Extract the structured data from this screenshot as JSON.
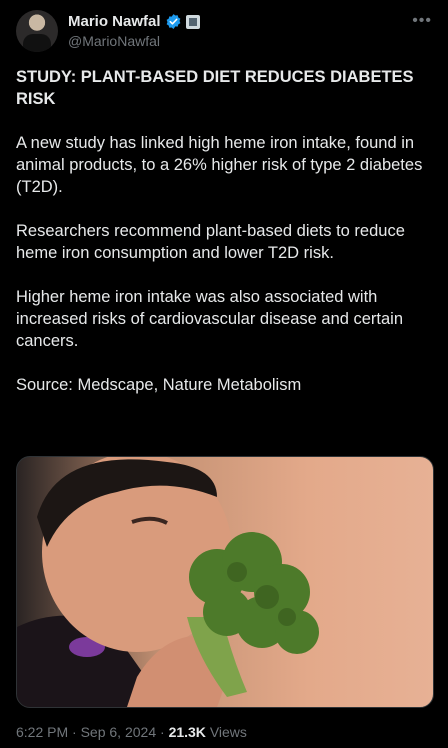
{
  "author": {
    "display_name": "Mario Nawfal",
    "handle": "@MarioNawfal",
    "verified_icon": "verified-badge-icon",
    "affiliation_icon": "affiliation-badge-icon"
  },
  "more_icon": "more-horizontal-icon",
  "post": {
    "headline": "STUDY: PLANT-BASED DIET REDUCES DIABETES RISK",
    "paragraphs": [
      "A new study has linked high heme iron intake, found in animal products, to a 26% higher risk of type 2 diabetes (T2D).",
      "Researchers recommend plant-based diets to reduce heme iron consumption and lower T2D risk.",
      "Higher heme iron intake was also associated with increased risks of cardiovascular disease and certain cancers.",
      "Source: Medscape, Nature Metabolism"
    ]
  },
  "media": {
    "description_icon": "photo-man-eating-broccoli"
  },
  "meta": {
    "time": "6:22 PM",
    "sep1": "·",
    "date": "Sep 6, 2024",
    "sep2": "·",
    "views_count": "21.3K",
    "views_label": "Views"
  },
  "colors": {
    "background": "#000000",
    "text": "#e7e9ea",
    "secondary": "#71767b",
    "verified_blue": "#1d9bf0"
  }
}
